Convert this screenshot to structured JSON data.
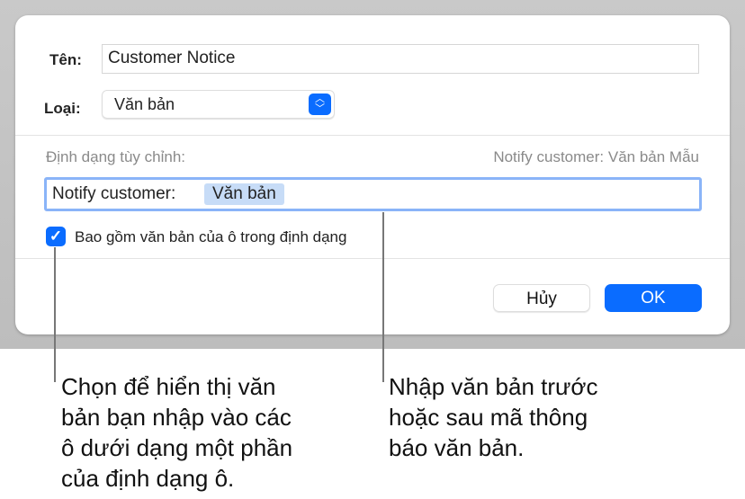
{
  "dialog": {
    "name_label": "Tên:",
    "name_value": "Customer Notice",
    "type_label": "Loại:",
    "type_value": "Văn bản",
    "custom_format_label": "Định dạng tùy chỉnh:",
    "preview": "Notify customer: Văn bản Mẫu",
    "format_prefix": "Notify customer:",
    "format_token": "Văn bản",
    "checkbox_label": "Bao gồm văn bản của ô trong định dạng",
    "checkbox_checked": true,
    "cancel": "Hủy",
    "ok": "OK"
  },
  "callouts": {
    "left": [
      "Chọn để hiển thị văn",
      "bản bạn nhập vào các",
      "ô dưới dạng một phần",
      "của định dạng ô."
    ],
    "right": [
      "Nhập văn bản trước",
      "hoặc sau mã thông",
      "báo văn bản."
    ]
  },
  "colors": {
    "accent": "#0a6cff",
    "token_bg": "#c7dcf7",
    "focus": "#8ab4f8"
  }
}
